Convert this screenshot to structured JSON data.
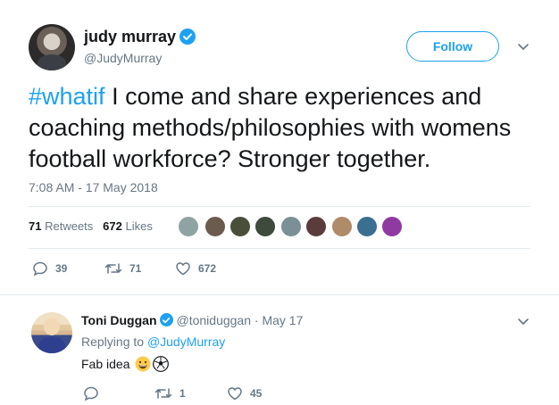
{
  "tweet": {
    "author_name": "judy murray",
    "author_handle": "@JudyMurray",
    "follow_label": "Follow",
    "hashtag": "#whatif",
    "text": " I come and share experiences and coaching methods/philosophies with womens football workforce? Stronger together.",
    "timestamp": "7:08 AM - 17 May 2018",
    "retweets_count": "71",
    "retweets_label": "Retweets",
    "likes_count": "672",
    "likes_label": "Likes",
    "actions": {
      "replies": "39",
      "retweets": "71",
      "likes": "672"
    },
    "likers_colors": [
      "#8fa3a3",
      "#6b5a4e",
      "#4a4f3a",
      "#3e4a3c",
      "#7a8f96",
      "#5a3c3c",
      "#b08b6a",
      "#3a6f8f",
      "#8f3aa0"
    ]
  },
  "reply": {
    "author_name": "Toni Duggan",
    "author_handle": "@toniduggan",
    "separator": " · ",
    "date": "May 17",
    "replying_prefix": "Replying to ",
    "replying_handle": "@JudyMurray",
    "text": "Fab idea",
    "actions": {
      "replies": "",
      "retweets": "1",
      "likes": "45"
    }
  },
  "colors": {
    "accent": "#1da1f2",
    "muted": "#657786",
    "text": "#14171a",
    "divider": "#e6ecf0"
  },
  "icons": [
    "verified-icon",
    "chevron-down-icon",
    "reply-icon",
    "retweet-icon",
    "like-icon",
    "grinning-face-emoji",
    "soccer-ball-emoji"
  ]
}
